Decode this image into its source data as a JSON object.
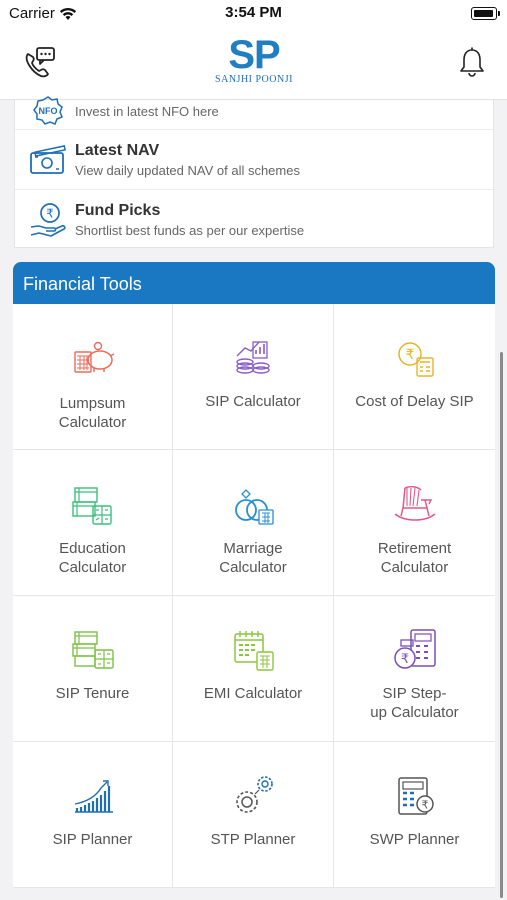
{
  "status_bar": {
    "carrier": "Carrier",
    "time": "3:54 PM"
  },
  "header": {
    "logo_text": "SP",
    "logo_subtitle": "SANJHI POONJI",
    "left_icon": "phone-chat-icon",
    "right_icon": "bell-icon"
  },
  "menu_list": [
    {
      "title": "",
      "description": "Invest in latest NFO here",
      "icon": "nfo-icon",
      "icon_text": "NFO"
    },
    {
      "title": "Latest NAV",
      "description": "View daily updated NAV of all schemes",
      "icon": "banknote-icon"
    },
    {
      "title": "Fund Picks",
      "description": "Shortlist best funds as per our expertise",
      "icon": "rupee-hand-icon"
    }
  ],
  "financial_tools": {
    "heading": "Financial Tools",
    "tools": [
      {
        "label": "Lumpsum\nCalculator",
        "icon": "piggy-bank-icon",
        "color": "#ef6a5a"
      },
      {
        "label": "SIP Calculator",
        "icon": "coins-chart-icon",
        "color": "#8a5cc9"
      },
      {
        "label": "Cost of Delay SIP",
        "icon": "rupee-calculator-icon",
        "color": "#e8b42a"
      },
      {
        "label": "Education\nCalculator",
        "icon": "education-icon",
        "color": "#3bbf7c"
      },
      {
        "label": "Marriage\nCalculator",
        "icon": "rings-icon",
        "color": "#2a8fd0"
      },
      {
        "label": "Retirement\nCalculator",
        "icon": "rocking-chair-icon",
        "color": "#e0598e"
      },
      {
        "label": "SIP Tenure",
        "icon": "tenure-icon",
        "color": "#7ac243"
      },
      {
        "label": "EMI Calculator",
        "icon": "calendar-calc-icon",
        "color": "#8cc63f"
      },
      {
        "label": "SIP Step-\nup Calculator",
        "icon": "stepup-icon",
        "color": "#7b4fb8"
      },
      {
        "label": "SIP Planner",
        "icon": "bar-growth-icon",
        "color": "#1f6fb5"
      },
      {
        "label": "STP Planner",
        "icon": "gears-icon",
        "color": "#555555"
      },
      {
        "label": "SWP Planner",
        "icon": "swp-calc-icon",
        "color": "#1f6fb5"
      }
    ]
  }
}
